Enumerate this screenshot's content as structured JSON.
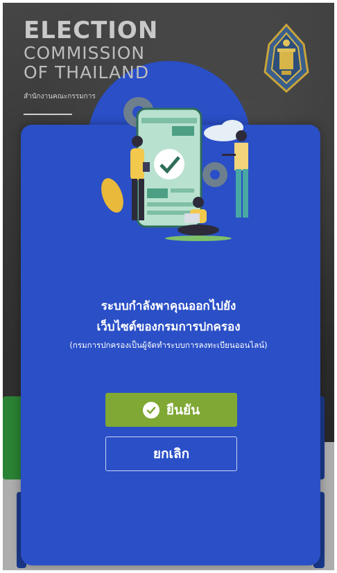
{
  "background": {
    "org_name_line1": "ELECTION",
    "org_name_line2": "COMMISSION",
    "org_name_line3": "OF THAILAND",
    "org_name_thai": "สำนักงานคณะกรรมการ",
    "emblem_icon": "ect-emblem-icon"
  },
  "modal": {
    "message_line1": "ระบบกำลังพาคุณออกไปยัง",
    "message_line2": "เว็บไซต์ของกรมการปกครอง",
    "message_note": "(กรมการปกครองเป็นผู้จัดทำระบบการลงทะเบียนออนไลน์)",
    "confirm_label": "ยืนยัน",
    "confirm_icon": "check-circle-icon",
    "cancel_label": "ยกเลิก"
  },
  "colors": {
    "modal_bg": "#2a4fc6",
    "confirm_bg": "#7fa834",
    "text": "#ffffff"
  }
}
